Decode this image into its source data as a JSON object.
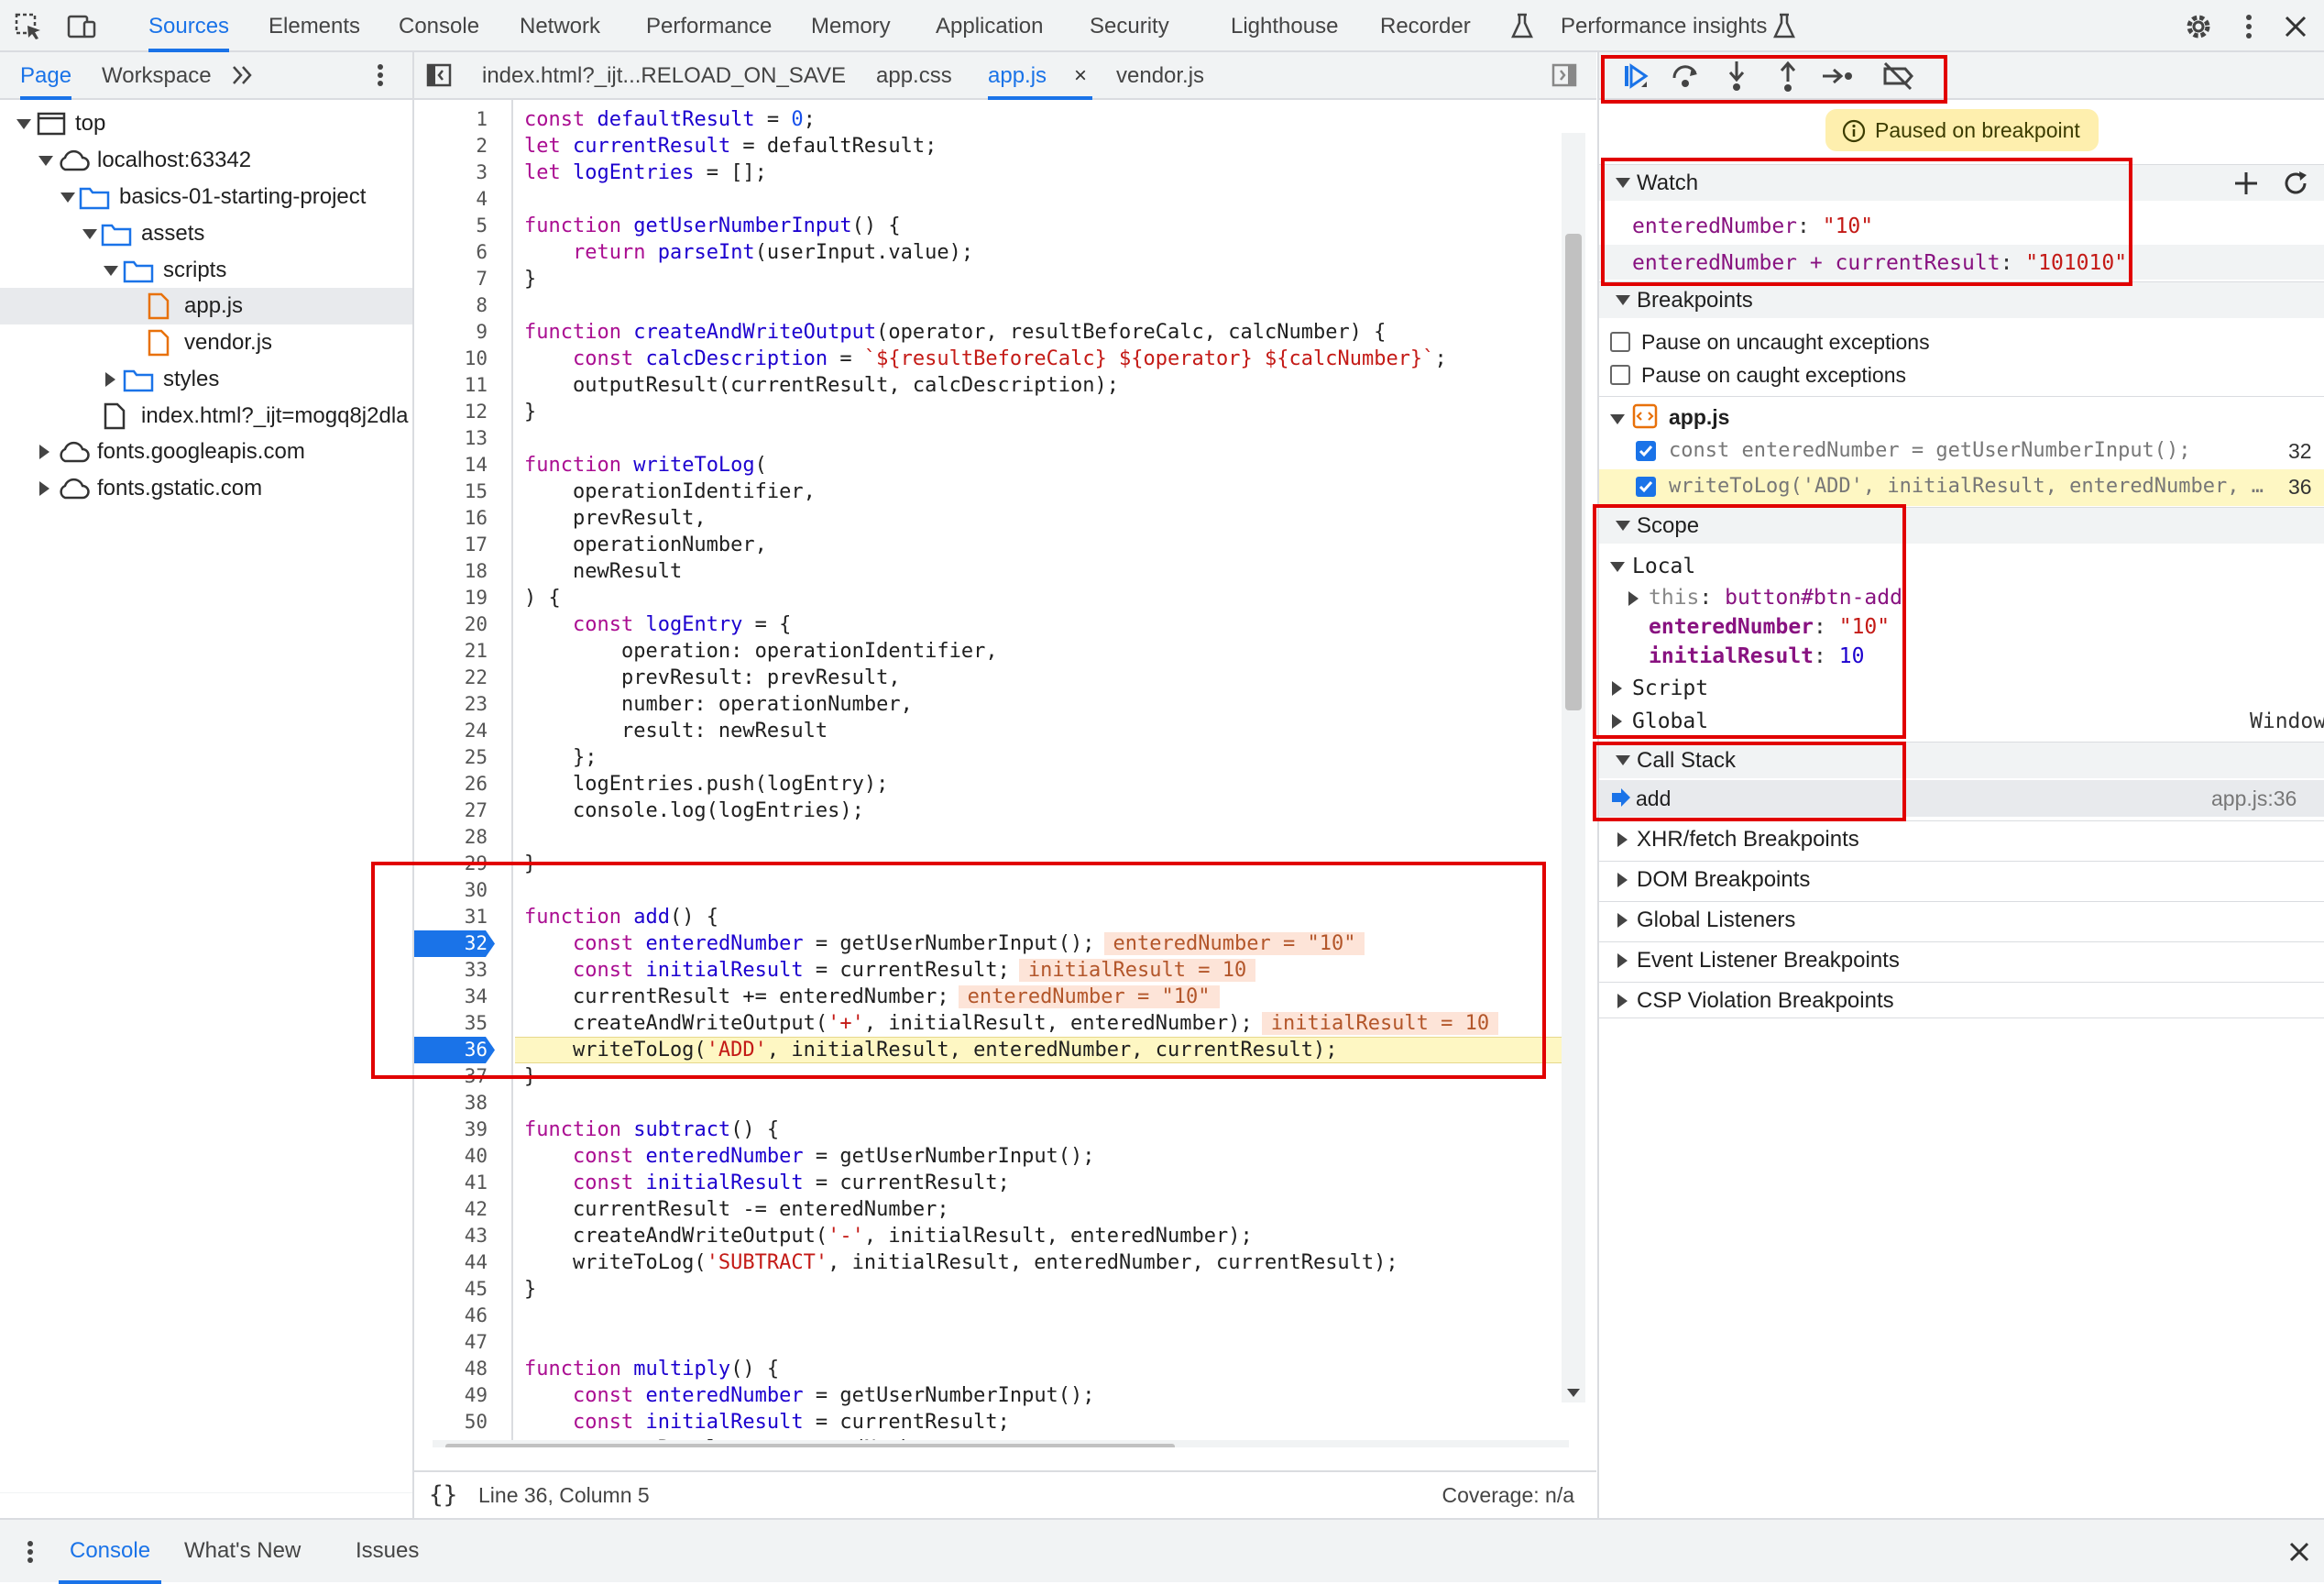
{
  "toolbar": {
    "tabs": [
      "Sources",
      "Elements",
      "Console",
      "Network",
      "Performance",
      "Memory",
      "Application",
      "Security",
      "Lighthouse",
      "Recorder",
      "Performance insights"
    ]
  },
  "navigator": {
    "tabs": [
      "Page",
      "Workspace"
    ],
    "tree": [
      "top",
      "localhost:63342",
      "basics-01-starting-project",
      "assets",
      "scripts",
      "app.js",
      "vendor.js",
      "styles",
      "index.html?_ijt=mogq8j2dla",
      "fonts.googleapis.com",
      "fonts.gstatic.com"
    ]
  },
  "editor": {
    "tabs": [
      "index.html?_ijt...RELOAD_ON_SAVE",
      "app.css",
      "app.js",
      "vendor.js"
    ],
    "lines": [
      "const defaultResult = 0;",
      "let currentResult = defaultResult;",
      "let logEntries = [];",
      "",
      "function getUserNumberInput() {",
      "    return parseInt(userInput.value);",
      "}",
      "",
      "function createAndWriteOutput(operator, resultBeforeCalc, calcNumber) {",
      "    const calcDescription = `${resultBeforeCalc} ${operator} ${calcNumber}`;",
      "    outputResult(currentResult, calcDescription);",
      "}",
      "",
      "function writeToLog(",
      "    operationIdentifier,",
      "    prevResult,",
      "    operationNumber,",
      "    newResult",
      ") {",
      "    const logEntry = {",
      "        operation: operationIdentifier,",
      "        prevResult: prevResult,",
      "        number: operationNumber,",
      "        result: newResult",
      "    };",
      "    logEntries.push(logEntry);",
      "    console.log(logEntries);",
      "",
      "}",
      "",
      "function add() {",
      "    const enteredNumber = getUserNumberInput();",
      "    const initialResult = currentResult;",
      "    currentResult += enteredNumber;",
      "    createAndWriteOutput('+', initialResult, enteredNumber);",
      "    writeToLog('ADD', initialResult, enteredNumber, currentResult);",
      "}",
      "",
      "function subtract() {",
      "    const enteredNumber = getUserNumberInput();",
      "    const initialResult = currentResult;",
      "    currentResult -= enteredNumber;",
      "    createAndWriteOutput('-', initialResult, enteredNumber);",
      "    writeToLog('SUBTRACT', initialResult, enteredNumber, currentResult);",
      "}",
      "",
      "",
      "function multiply() {",
      "    const enteredNumber = getUserNumberInput();",
      "    const initialResult = currentResult;",
      "    currentResult -= enteredNumber;"
    ],
    "inline_values": {
      "32": "enteredNumber = \"10\"",
      "33": "initialResult = 10",
      "34": "enteredNumber = \"10\"",
      "35": "initialResult = 10"
    },
    "breakpoint_lines": [
      32,
      36
    ],
    "current_line": 36
  },
  "status": {
    "position": "Line 36, Column 5",
    "coverage": "Coverage: n/a"
  },
  "debugger": {
    "paused_label": "Paused on breakpoint",
    "watch": {
      "title": "Watch",
      "items": [
        {
          "expr": "enteredNumber",
          "value": "\"10\""
        },
        {
          "expr": "enteredNumber + currentResult",
          "value": "\"101010\""
        }
      ]
    },
    "breakpoints": {
      "title": "Breakpoints",
      "pause_uncaught": "Pause on uncaught exceptions",
      "pause_caught": "Pause on caught exceptions",
      "file": "app.js",
      "items": [
        {
          "code": "const enteredNumber = getUserNumberInput();",
          "line": "32"
        },
        {
          "code": "writeToLog('ADD', initialResult, enteredNumber, …",
          "line": "36"
        }
      ]
    },
    "scope": {
      "title": "Scope",
      "local": "Local",
      "this_key": "this",
      "this_val": "button#btn-add",
      "entered_key": "enteredNumber",
      "entered_val": "\"10\"",
      "initial_key": "initialResult",
      "initial_val": "10",
      "script": "Script",
      "global": "Global",
      "global_val": "Window"
    },
    "callstack": {
      "title": "Call Stack",
      "frame": "add",
      "loc": "app.js:36"
    },
    "other_sections": [
      "XHR/fetch Breakpoints",
      "DOM Breakpoints",
      "Global Listeners",
      "Event Listener Breakpoints",
      "CSP Violation Breakpoints"
    ]
  },
  "drawer": {
    "tabs": [
      "Console",
      "What's New",
      "Issues"
    ]
  },
  "colors": {
    "accent": "#1a73e8",
    "annotation_red": "#e10000",
    "paused_bg": "#feefae",
    "current_line_bg": "#fef7c3"
  }
}
